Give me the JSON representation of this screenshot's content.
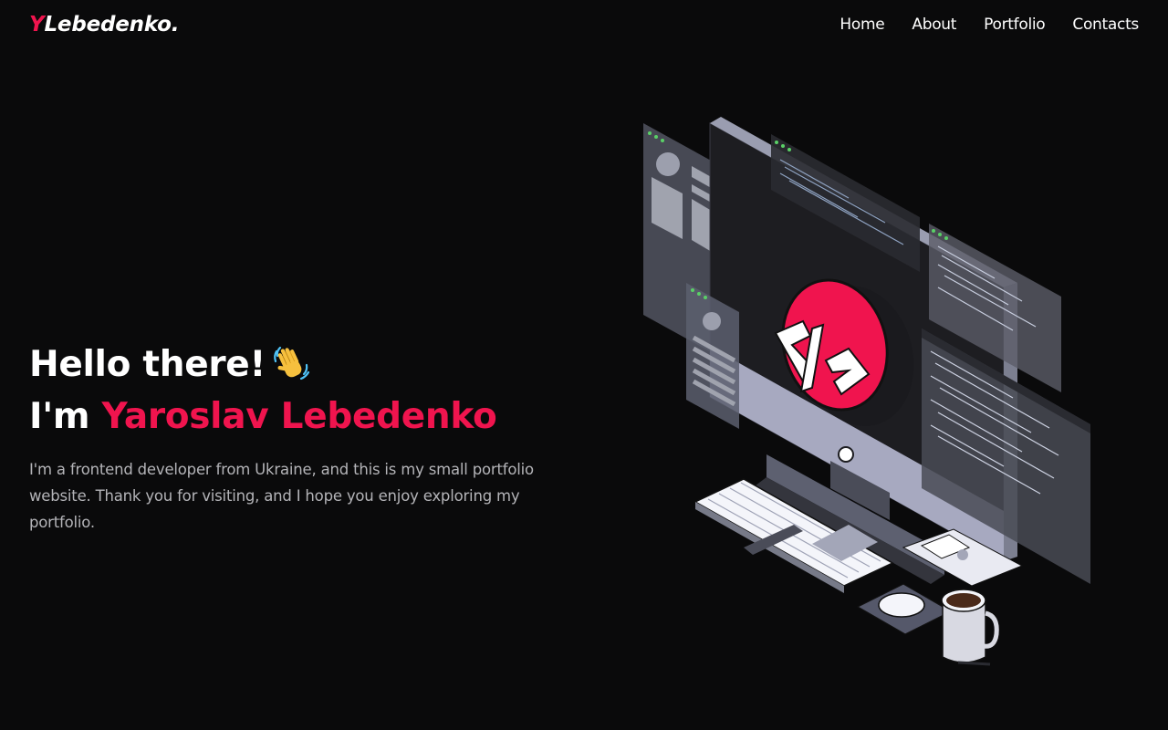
{
  "header": {
    "logo_initial": "Y",
    "logo_text": "Lebedenko.",
    "nav": [
      {
        "label": "Home"
      },
      {
        "label": "About"
      },
      {
        "label": "Portfolio"
      },
      {
        "label": "Contacts"
      }
    ]
  },
  "hero": {
    "greeting": "Hello there!",
    "greeting_icon": "waving-hand-icon",
    "intro_prefix": "I'm ",
    "name": "Yaroslav Lebedenko",
    "description": "I'm a frontend developer from Ukraine, and this is my small portfolio website. Thank you for visiting, and I hope you enjoy exploring my portfolio."
  },
  "illustration": {
    "icon": "developer-workstation-illustration",
    "code_symbol": "</>"
  },
  "colors": {
    "background": "#0a0a0b",
    "accent": "#f0144e",
    "text": "#ffffff",
    "muted_text": "#b4b4b8"
  }
}
